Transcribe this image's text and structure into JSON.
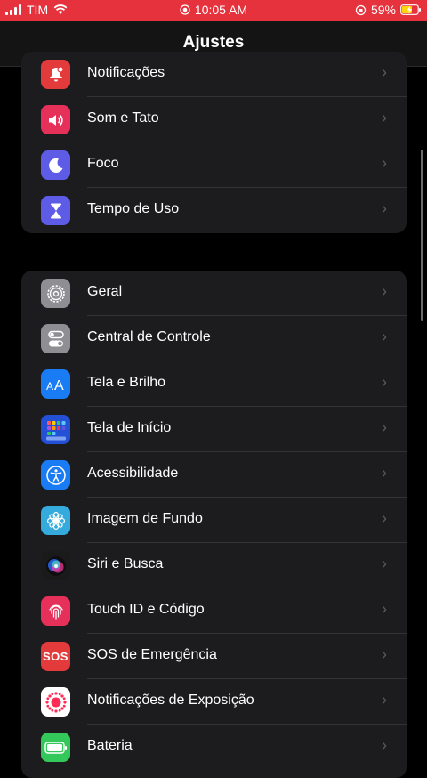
{
  "status_bar": {
    "carrier": "TIM",
    "time": "10:05 AM",
    "battery": "59%"
  },
  "nav": {
    "title": "Ajustes"
  },
  "group1": [
    {
      "label": "Notificações",
      "icon": "bell-icon",
      "color": "#e33b3b"
    },
    {
      "label": "Som e Tato",
      "icon": "speaker-icon",
      "color": "#e5305a"
    },
    {
      "label": "Foco",
      "icon": "moon-icon",
      "color": "#5e5ce6"
    },
    {
      "label": "Tempo de Uso",
      "icon": "hourglass-icon",
      "color": "#5e5ce6"
    }
  ],
  "group2": [
    {
      "label": "Geral",
      "icon": "gear-icon",
      "color": "#8e8e93"
    },
    {
      "label": "Central de Controle",
      "icon": "toggles-icon",
      "color": "#8e8e93"
    },
    {
      "label": "Tela e Brilho",
      "icon": "text-size-icon",
      "color": "#1a7cf5"
    },
    {
      "label": "Tela de Início",
      "icon": "home-grid-icon",
      "color": "#2450d6"
    },
    {
      "label": "Acessibilidade",
      "icon": "accessibility-icon",
      "color": "#1a7cf5"
    },
    {
      "label": "Imagem de Fundo",
      "icon": "flower-icon",
      "color": "#35aadc"
    },
    {
      "label": "Siri e Busca",
      "icon": "siri-icon",
      "color": "#1a1a1a"
    },
    {
      "label": "Touch ID e Código",
      "icon": "fingerprint-icon",
      "color": "#e5305a"
    },
    {
      "label": "SOS de Emergência",
      "icon": "sos-icon",
      "color": "#e33b3b",
      "icon_text": "SOS"
    },
    {
      "label": "Notificações de Exposição",
      "icon": "exposure-icon",
      "color": "#ffffff"
    },
    {
      "label": "Bateria",
      "icon": "battery-icon",
      "color": "#34c759"
    }
  ]
}
